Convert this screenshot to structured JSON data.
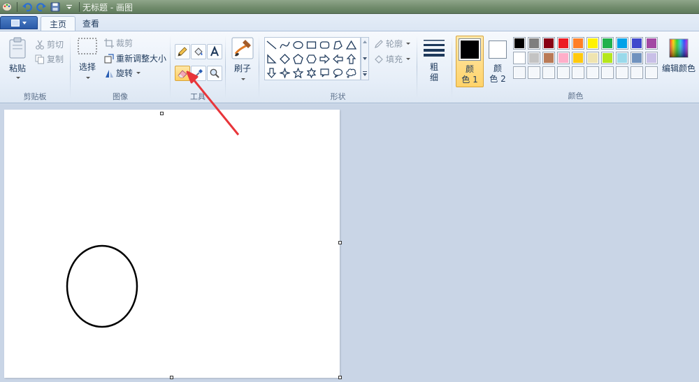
{
  "window": {
    "title": "无标题 - 画图"
  },
  "tabs": [
    {
      "label": "主页",
      "active": true
    },
    {
      "label": "查看",
      "active": false
    }
  ],
  "clipboard": {
    "paste_label": "粘贴",
    "cut_label": "剪切",
    "copy_label": "复制",
    "group_label": "剪贴板"
  },
  "image": {
    "select_label": "选择",
    "crop_label": "裁剪",
    "resize_label": "重新调整大小",
    "rotate_label": "旋转",
    "group_label": "图像"
  },
  "tools": {
    "group_label": "工具",
    "selected_tool": "eraser"
  },
  "brushes": {
    "label": "刷子"
  },
  "shapes": {
    "outline_label": "轮廓",
    "fill_label": "填充",
    "group_label": "形状",
    "items": [
      "line",
      "curve",
      "oval",
      "rectangle",
      "rounded-rectangle",
      "polygon",
      "triangle",
      "right-triangle",
      "diamond",
      "pentagon",
      "hexagon",
      "right-arrow",
      "left-arrow",
      "up-arrow",
      "down-arrow",
      "four-point-star",
      "five-point-star",
      "six-point-star",
      "rounded-callout",
      "oval-callout",
      "cloud-callout"
    ]
  },
  "size": {
    "label_top": "粗",
    "label_bottom": "细"
  },
  "colors": {
    "color1_top": "颜",
    "color1_bottom": "色 1",
    "color1_value": "#000000",
    "color2_top": "颜",
    "color2_bottom": "色 2",
    "color2_value": "#ffffff",
    "edit_label": "编辑颜色",
    "group_label": "颜色",
    "palette_row1": [
      "#000000",
      "#7f7f7f",
      "#880015",
      "#ed1c24",
      "#ff7f27",
      "#fff200",
      "#22b14c",
      "#00a2e8",
      "#3f48cc",
      "#a349a4"
    ],
    "palette_row2": [
      "#ffffff",
      "#c3c3c3",
      "#b97a57",
      "#ffaec9",
      "#ffc90e",
      "#efe4b0",
      "#b5e61d",
      "#99d9ea",
      "#7092be",
      "#c8bfe7"
    ],
    "palette_row3": [
      "",
      "",
      "",
      "",
      "",
      "",
      "",
      "",
      "",
      ""
    ]
  },
  "accent": "#e8353a"
}
